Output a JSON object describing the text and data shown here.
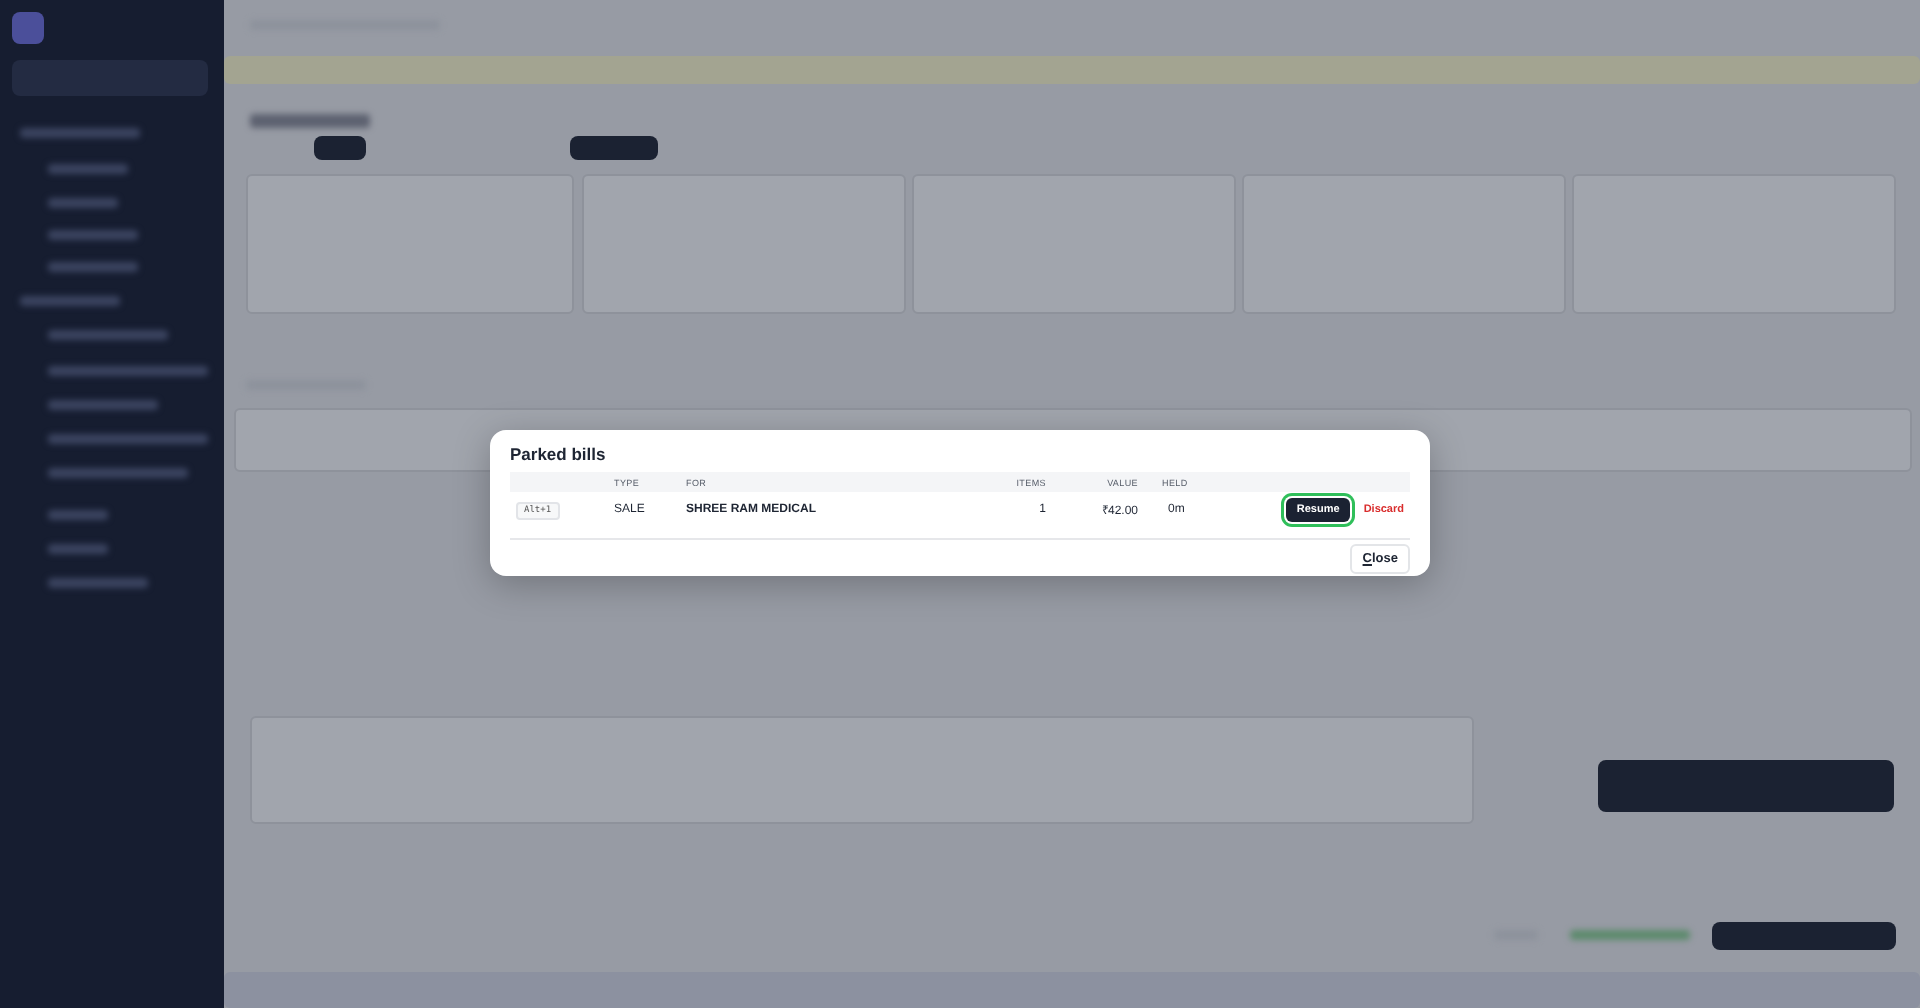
{
  "dialog": {
    "title": "Parked bills",
    "columns": [
      "TYPE",
      "FOR",
      "ITEMS",
      "VALUE",
      "HELD"
    ],
    "rows": [
      {
        "shortcut": "Alt+1",
        "type": "SALE",
        "for": "SHREE RAM MEDICAL",
        "items": "1",
        "value": "₹42.00",
        "held": "0m",
        "resume": {
          "label": "Resume",
          "focused": true
        },
        "discard": "Discard"
      }
    ],
    "close": "Close"
  }
}
